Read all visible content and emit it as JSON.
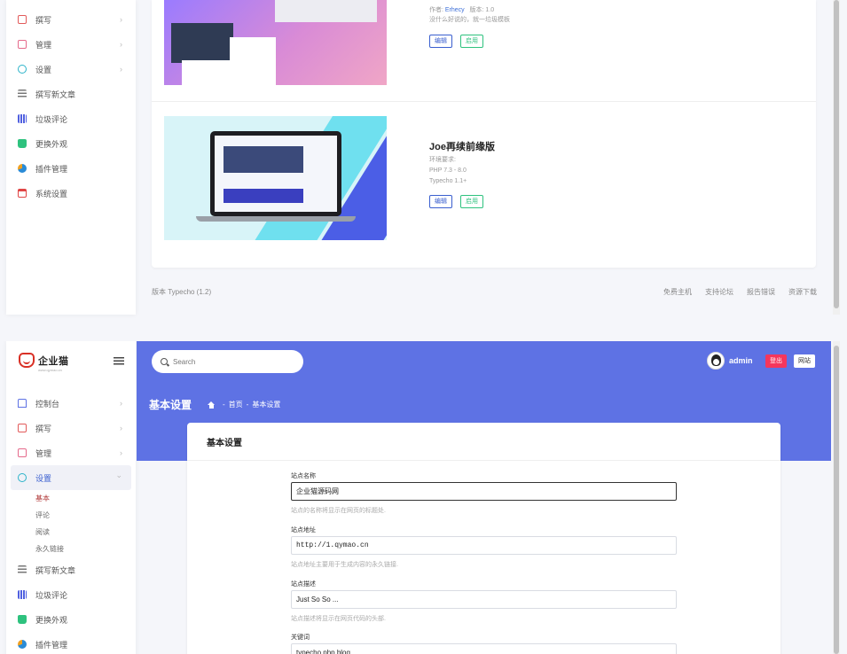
{
  "top": {
    "sidebar": {
      "items": [
        {
          "label": "撰写",
          "icon": "compose-icon",
          "chevron": "›"
        },
        {
          "label": "管理",
          "icon": "manage-icon",
          "chevron": "›"
        },
        {
          "label": "设置",
          "icon": "settings-icon",
          "chevron": "›"
        },
        {
          "label": "撰写新文章",
          "icon": "new-post-icon"
        },
        {
          "label": "垃圾评论",
          "icon": "spam-comments-icon"
        },
        {
          "label": "更换外观",
          "icon": "appearance-icon"
        },
        {
          "label": "插件管理",
          "icon": "plugins-icon"
        },
        {
          "label": "系统设置",
          "icon": "system-settings-icon"
        }
      ]
    },
    "plugins": [
      {
        "author_label": "作者: ",
        "author": "Erhecy",
        "version_label": "版本: 1.0",
        "description": "没什么好说的，就一垃圾模板",
        "edit_label": "编辑",
        "enable_label": "启用"
      },
      {
        "title": "Joe再续前缘版",
        "env_label": "环境要求:",
        "php": "PHP 7.3 - 8.0",
        "typecho": "Typecho 1.1+",
        "edit_label": "编辑",
        "enable_label": "启用"
      }
    ],
    "footer": {
      "version": "版本 Typecho (1.2)",
      "links": [
        "免费主机",
        "支持论坛",
        "报告错误",
        "资源下载"
      ]
    }
  },
  "bottom": {
    "logo_text": "企业猫",
    "logo_sub": "www.qymao.cn",
    "sidebar": {
      "items": [
        {
          "label": "控制台",
          "icon": "dashboard-icon",
          "chevron": "›"
        },
        {
          "label": "撰写",
          "icon": "compose-icon",
          "chevron": "›"
        },
        {
          "label": "管理",
          "icon": "manage-icon",
          "chevron": "›"
        },
        {
          "label": "设置",
          "icon": "settings-icon",
          "chevron": "⌄"
        }
      ],
      "subitems": [
        "基本",
        "评论",
        "阅读",
        "永久链接"
      ],
      "items_after": [
        {
          "label": "撰写新文章",
          "icon": "new-post-icon"
        },
        {
          "label": "垃圾评论",
          "icon": "spam-comments-icon"
        },
        {
          "label": "更换外观",
          "icon": "appearance-icon"
        },
        {
          "label": "插件管理",
          "icon": "plugins-icon"
        }
      ]
    },
    "header": {
      "search_placeholder": "Search",
      "username": "admin",
      "logout_label": "登出",
      "site_label": "网站",
      "page_title": "基本设置",
      "breadcrumb": [
        "首页",
        "基本设置"
      ]
    },
    "form": {
      "title": "基本设置",
      "fields": [
        {
          "label": "站点名称",
          "value": "企业猫源码网",
          "help": "站点的名称将显示在网页的标题处."
        },
        {
          "label": "站点地址",
          "value": "http://1.qymao.cn",
          "help": "站点地址主要用于生成内容的永久链接."
        },
        {
          "label": "站点描述",
          "value": "Just So So ...",
          "help": "站点描述将显示在网页代码的头部."
        },
        {
          "label": "关键词",
          "value": "typecho,php,blog"
        }
      ]
    }
  },
  "colors": {
    "accent": "#5e72e4",
    "logout": "#f5365c",
    "enable": "#2ec27e",
    "edit": "#3a5fcf"
  }
}
